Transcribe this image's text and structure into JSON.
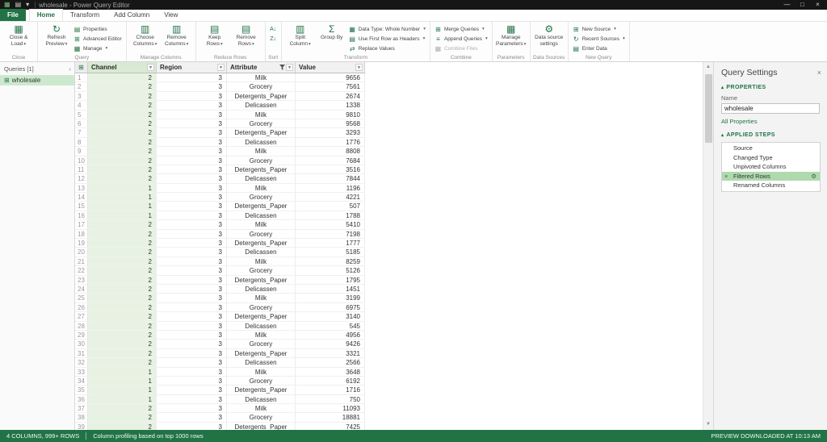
{
  "titlebar": {
    "title": "wholesale - Power Query Editor"
  },
  "icons": {
    "app": "▦",
    "save": "▤",
    "caret": "▾",
    "minimize": "—",
    "maximize": "□",
    "close": "×",
    "close_load": "▦",
    "refresh": "↻",
    "properties": "▤",
    "advanced_editor": "⊞",
    "manage": "▦",
    "choose_columns": "▥",
    "remove_columns": "▥",
    "keep_rows": "▤",
    "remove_rows": "▤",
    "sort_az": "A↓",
    "sort_za": "Z↓",
    "split_column": "▥",
    "group_by": "Σ",
    "data_type": "▦",
    "first_row": "▤",
    "replace_values": "⇄",
    "merge": "⊞",
    "append": "≡",
    "combine_files": "▦",
    "manage_parameters": "▦",
    "data_source": "⚙",
    "new_source": "⊞",
    "recent_sources": "↻",
    "enter_data": "▤",
    "table": "⊞",
    "gear": "⚙",
    "delete": "×",
    "collapse": "▴",
    "chevron": "‹",
    "scroll_up": "▲",
    "scroll_down": "▼"
  },
  "ribbon": {
    "active_tab": "Home",
    "tabs": [
      {
        "label": "File",
        "file": true
      },
      {
        "label": "Home"
      },
      {
        "label": "Transform"
      },
      {
        "label": "Add Column"
      },
      {
        "label": "View"
      }
    ],
    "close_group": {
      "label": "Close",
      "close_load": "Close & Load"
    },
    "query_group": {
      "label": "Query",
      "refresh": "Refresh Preview",
      "properties": "Properties",
      "advanced_editor": "Advanced Editor",
      "manage": "Manage"
    },
    "manage_columns_group": {
      "label": "Manage Columns",
      "choose": "Choose Columns",
      "remove": "Remove Columns"
    },
    "reduce_rows_group": {
      "label": "Reduce Rows",
      "keep": "Keep Rows",
      "remove": "Remove Rows"
    },
    "sort_group": {
      "label": "Sort"
    },
    "transform_group": {
      "label": "Transform",
      "split": "Split Column",
      "group_by": "Group By",
      "data_type": "Data Type: Whole Number",
      "first_row": "Use First Row as Headers",
      "replace": "Replace Values"
    },
    "combine_group": {
      "label": "Combine",
      "merge": "Merge Queries",
      "append": "Append Queries",
      "combine_files": "Combine Files"
    },
    "parameters_group": {
      "label": "Parameters",
      "manage_parameters": "Manage Parameters"
    },
    "data_sources_group": {
      "label": "Data Sources",
      "settings": "Data source settings"
    },
    "new_query_group": {
      "label": "New Query",
      "new_source": "New Source",
      "recent": "Recent Sources",
      "enter_data": "Enter Data"
    }
  },
  "queries_panel": {
    "header": "Queries [1]",
    "items": [
      {
        "name": "wholesale",
        "selected": true
      }
    ]
  },
  "table": {
    "columns": [
      {
        "name": "Channel",
        "selected": true
      },
      {
        "name": "Region"
      },
      {
        "name": "Attribute",
        "filtered": true
      },
      {
        "name": "Value"
      }
    ],
    "rows": [
      [
        2,
        3,
        "Milk",
        9656
      ],
      [
        2,
        3,
        "Grocery",
        7561
      ],
      [
        2,
        3,
        "Detergents_Paper",
        2674
      ],
      [
        2,
        3,
        "Delicassen",
        1338
      ],
      [
        2,
        3,
        "Milk",
        9810
      ],
      [
        2,
        3,
        "Grocery",
        9568
      ],
      [
        2,
        3,
        "Detergents_Paper",
        3293
      ],
      [
        2,
        3,
        "Delicassen",
        1776
      ],
      [
        2,
        3,
        "Milk",
        8808
      ],
      [
        2,
        3,
        "Grocery",
        7684
      ],
      [
        2,
        3,
        "Detergents_Paper",
        3516
      ],
      [
        2,
        3,
        "Delicassen",
        7844
      ],
      [
        1,
        3,
        "Milk",
        1196
      ],
      [
        1,
        3,
        "Grocery",
        4221
      ],
      [
        1,
        3,
        "Detergents_Paper",
        507
      ],
      [
        1,
        3,
        "Delicassen",
        1788
      ],
      [
        2,
        3,
        "Milk",
        5410
      ],
      [
        2,
        3,
        "Grocery",
        7198
      ],
      [
        2,
        3,
        "Detergents_Paper",
        1777
      ],
      [
        2,
        3,
        "Delicassen",
        5185
      ],
      [
        2,
        3,
        "Milk",
        8259
      ],
      [
        2,
        3,
        "Grocery",
        5126
      ],
      [
        2,
        3,
        "Detergents_Paper",
        1795
      ],
      [
        2,
        3,
        "Delicassen",
        1451
      ],
      [
        2,
        3,
        "Milk",
        3199
      ],
      [
        2,
        3,
        "Grocery",
        6975
      ],
      [
        2,
        3,
        "Detergents_Paper",
        3140
      ],
      [
        2,
        3,
        "Delicassen",
        545
      ],
      [
        2,
        3,
        "Milk",
        4956
      ],
      [
        2,
        3,
        "Grocery",
        9426
      ],
      [
        2,
        3,
        "Detergents_Paper",
        3321
      ],
      [
        2,
        3,
        "Delicassen",
        2566
      ],
      [
        1,
        3,
        "Milk",
        3648
      ],
      [
        1,
        3,
        "Grocery",
        6192
      ],
      [
        1,
        3,
        "Detergents_Paper",
        1716
      ],
      [
        1,
        3,
        "Delicassen",
        750
      ],
      [
        2,
        3,
        "Milk",
        11093
      ],
      [
        2,
        3,
        "Grocery",
        18881
      ],
      [
        2,
        3,
        "Detergents_Paper",
        7425
      ]
    ]
  },
  "settings_panel": {
    "title": "Query Settings",
    "properties_header": "PROPERTIES",
    "name_label": "Name",
    "name_value": "wholesale",
    "all_properties": "All Properties",
    "applied_steps_header": "APPLIED STEPS",
    "steps": [
      {
        "name": "Source"
      },
      {
        "name": "Changed Type"
      },
      {
        "name": "Unpivoted Columns"
      },
      {
        "name": "Filtered Rows",
        "selected": true,
        "has_settings": true
      },
      {
        "name": "Renamed Columns"
      }
    ]
  },
  "statusbar": {
    "left": "4 COLUMNS, 999+ ROWS",
    "middle": "Column profiling based on top 1000 rows",
    "right": "PREVIEW DOWNLOADED AT 10:13 AM"
  }
}
